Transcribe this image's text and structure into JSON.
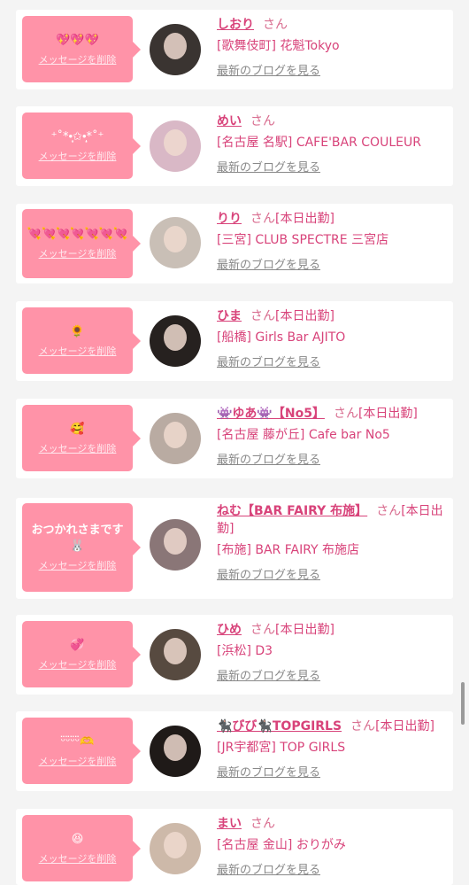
{
  "theme": {
    "bubble_color": "#ff93a8",
    "name_color": "#d8437a",
    "link_color": "#888888",
    "card_background": "#ffffff",
    "page_background": "#f4f4f4"
  },
  "delete_label": "メッセージを削除",
  "blog_label": "最新のブログを見る",
  "honorific": "さん",
  "cards": [
    {
      "message": "💖💖💖",
      "name": "しおり",
      "status": "",
      "shop": "[歌舞伎町] 花魁Tokyo",
      "avatar_color": "#3a3431"
    },
    {
      "message": "⁺˚*•̩̩͙✩•̩̩͙*˚⁺",
      "name": "めい",
      "status": "",
      "shop": "[名古屋 名駅] CAFE'BAR COULEUR",
      "avatar_color": "#d9b8c6"
    },
    {
      "message": "💘💘💘💘💘💘💘",
      "name": "りり",
      "status": "[本日出勤]",
      "shop": "[三宮] CLUB SPECTRE 三宮店",
      "avatar_color": "#c9bfb6"
    },
    {
      "message": "🌻",
      "name": "ひま",
      "status": "[本日出勤]",
      "shop": "[船橋] Girls Bar AJITO",
      "avatar_color": "#26211f"
    },
    {
      "message": "🥰",
      "name": "👾ゆあ👾【No5】",
      "status": "[本日出勤]",
      "shop": "[名古屋 藤が丘] Cafe bar No5",
      "avatar_color": "#b9aba2"
    },
    {
      "message": "おつかれさまです🐰",
      "name": "ねむ【BAR FAIRY 布施】",
      "status": "[本日出勤]",
      "shop": "[布施] BAR FAIRY 布施店",
      "avatar_color": "#8a7677"
    },
    {
      "message": "💞",
      "name": "ひめ",
      "status": "[本日出勤]",
      "shop": "[浜松] D3",
      "avatar_color": "#574a40"
    },
    {
      "message": "ᵕ̈ᵕ̈ᵕ̈ᵕ̈🫶",
      "name": "🐈‍⬛びび🐈‍⬛TOPGIRLS",
      "status": "[本日出勤]",
      "shop": "[JR宇都宮] TOP GIRLS",
      "avatar_color": "#1f1a18"
    },
    {
      "message": "😆",
      "name": "まい",
      "status": "",
      "shop": "[名古屋 金山] おりがみ",
      "avatar_color": "#cdb9a9"
    }
  ]
}
